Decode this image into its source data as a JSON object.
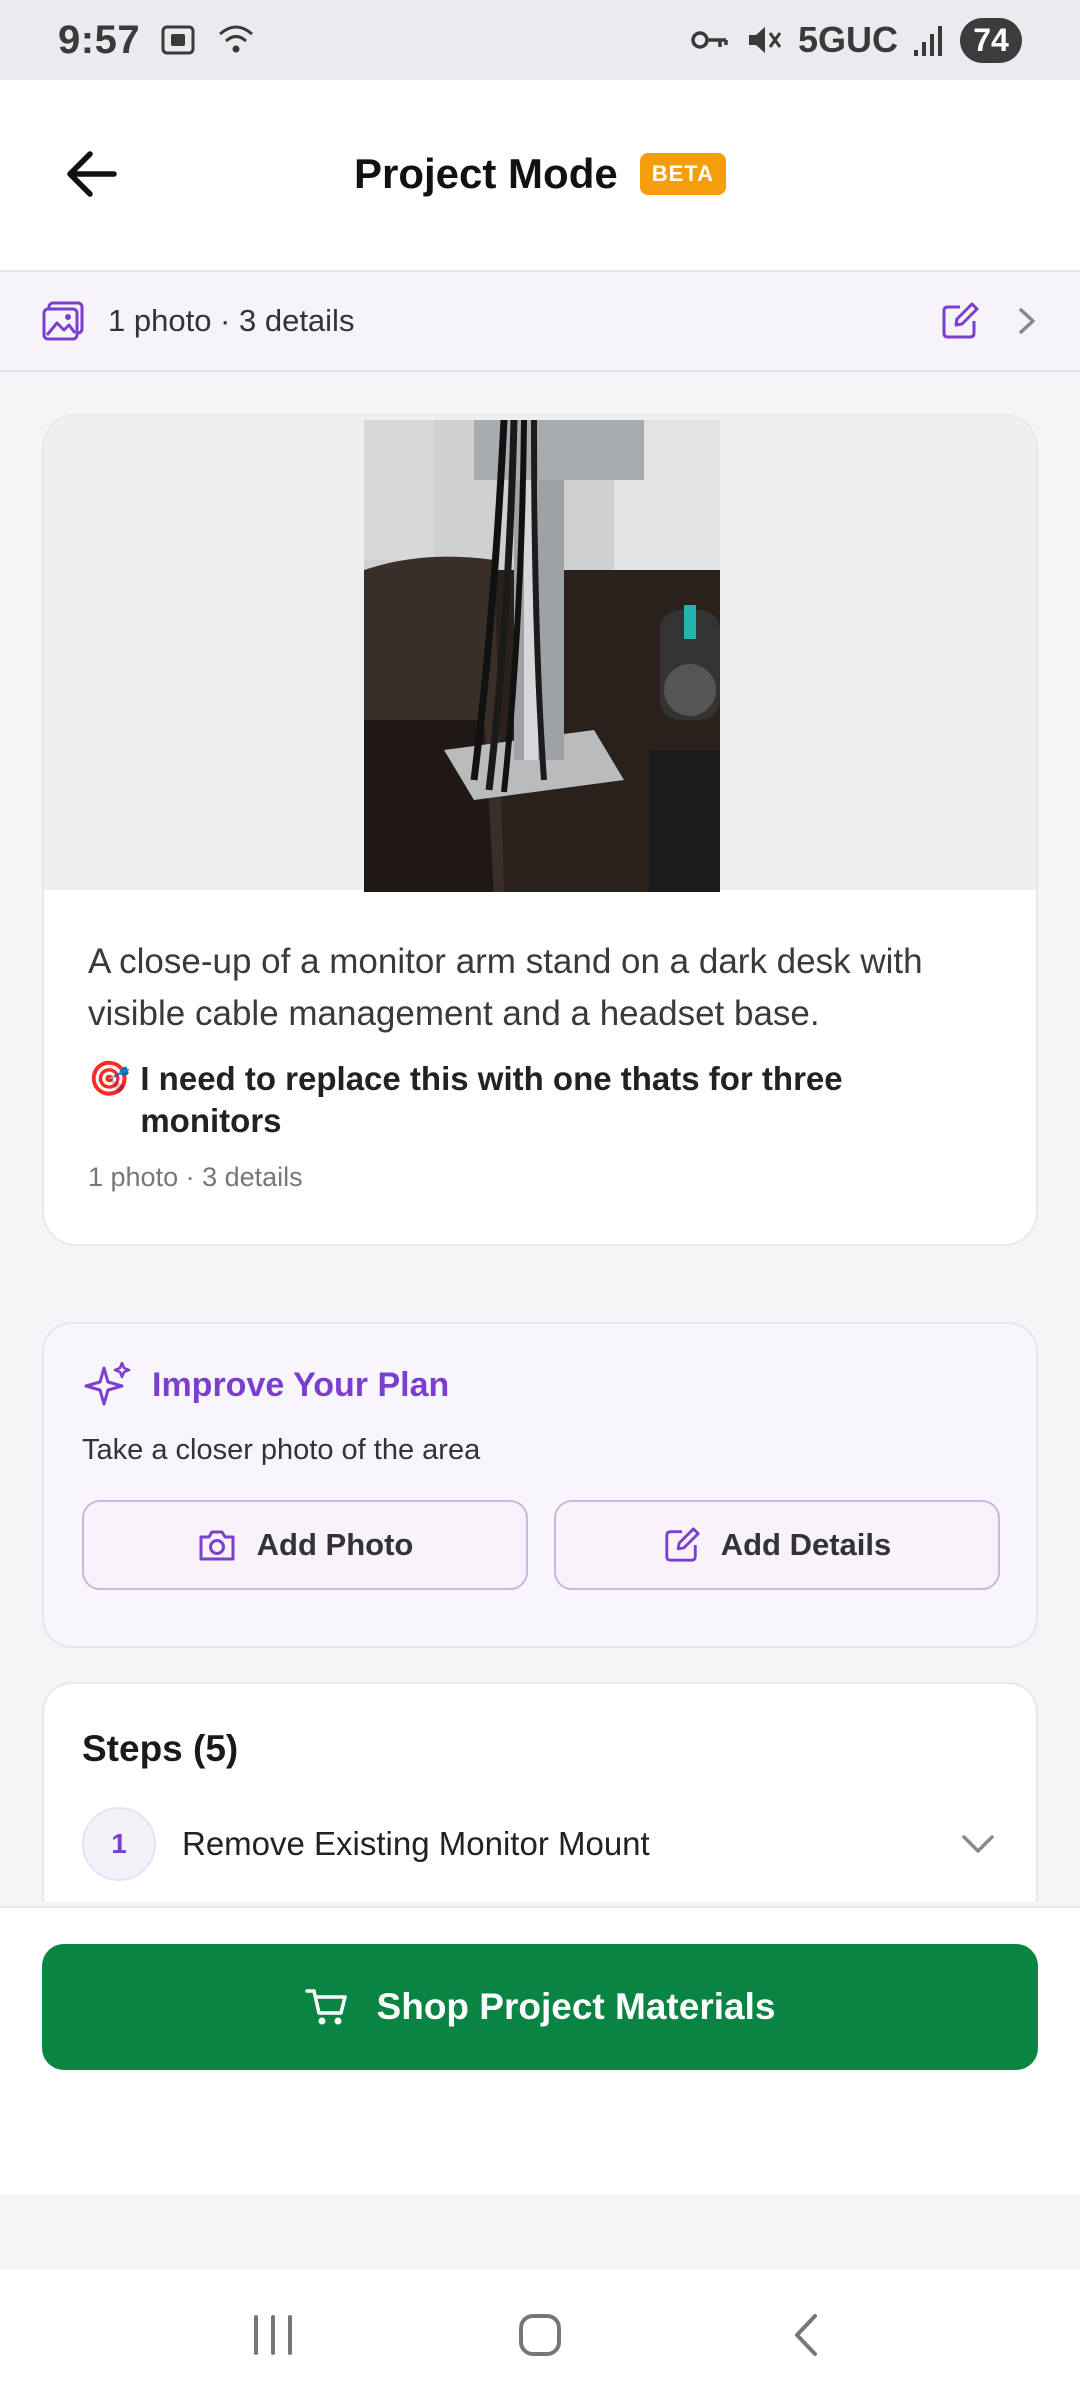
{
  "status_bar": {
    "time": "9:57",
    "network": "5GUC",
    "battery": "74"
  },
  "header": {
    "title": "Project Mode",
    "badge": "BETA"
  },
  "summary": {
    "text": "1 photo · 3 details"
  },
  "project_card": {
    "description": "A close-up of a monitor arm stand on a dark desk with visible cable management and a headset base.",
    "goal_emoji": "🎯",
    "goal": "I need to replace this with one thats for three monitors",
    "meta": "1 photo · 3 details"
  },
  "improve": {
    "title": "Improve Your Plan",
    "subtitle": "Take a closer photo of the area",
    "add_photo_label": "Add Photo",
    "add_details_label": "Add Details"
  },
  "steps": {
    "title": "Steps (5)",
    "items": [
      {
        "number": "1",
        "label": "Remove Existing Monitor Mount"
      }
    ]
  },
  "cta": {
    "shop_label": "Shop Project Materials"
  },
  "colors": {
    "accent_purple": "#7b3fd0",
    "beta_orange": "#f59e0b",
    "shop_green": "#0a8443"
  }
}
